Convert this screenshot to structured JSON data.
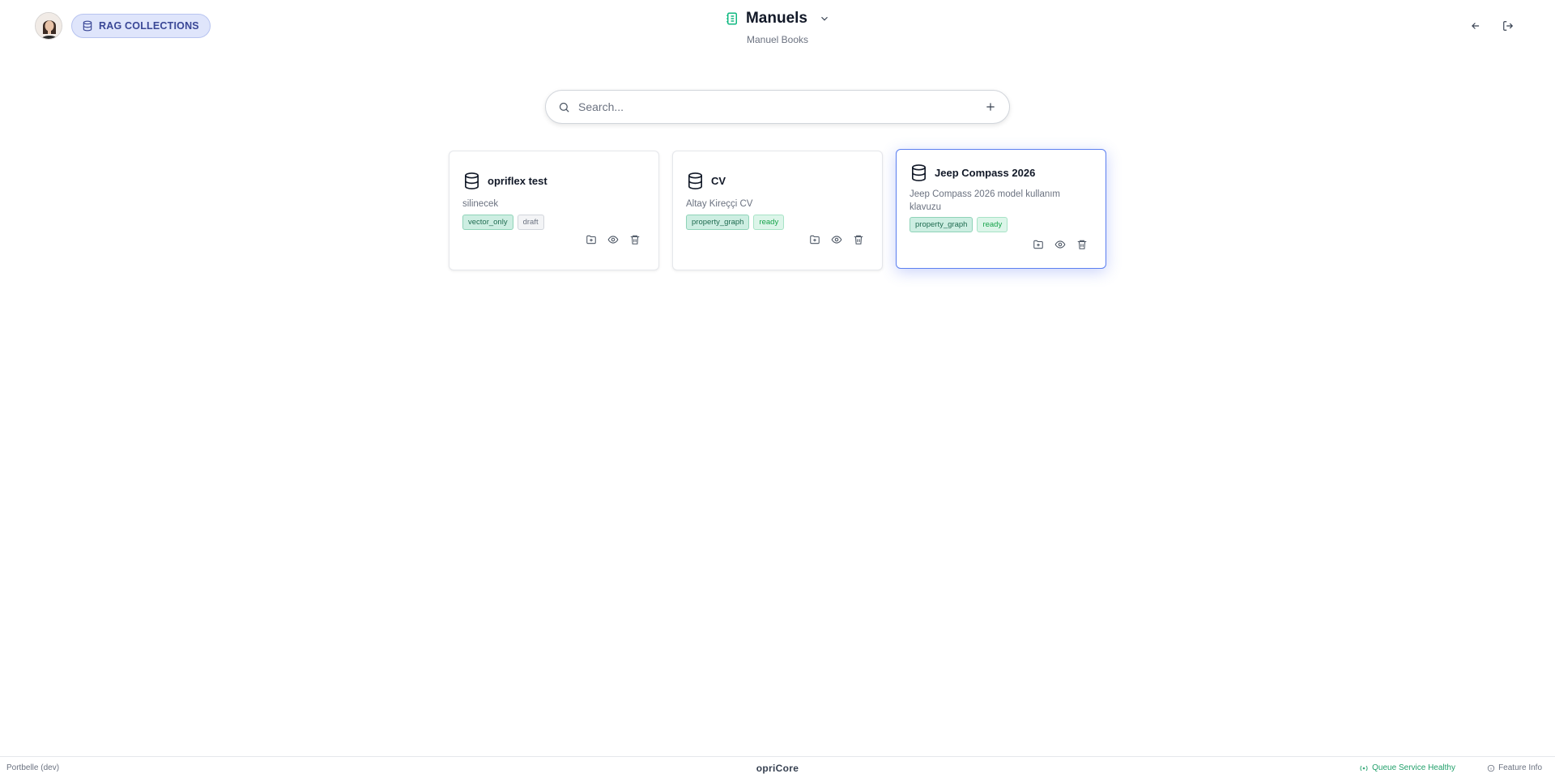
{
  "header": {
    "section_label": "RAG COLLECTIONS",
    "title": "Manuels",
    "subtitle": "Manuel Books"
  },
  "search": {
    "placeholder": "Search..."
  },
  "collections": [
    {
      "name": "opriflex test",
      "description": "silinecek",
      "type_tag": "vector_only",
      "status_tag": "draft"
    },
    {
      "name": "CV",
      "description": "Altay Kireççi CV",
      "type_tag": "property_graph",
      "status_tag": "ready"
    },
    {
      "name": "Jeep Compass 2026",
      "description": "Jeep Compass 2026 model kullanım klavuzu",
      "type_tag": "property_graph",
      "status_tag": "ready",
      "selected": true
    }
  ],
  "footer": {
    "environment": "Portbelle (dev)",
    "brand": "opriCore",
    "queue_status": "Queue Service Healthy",
    "feature_info": "Feature Info"
  },
  "colors": {
    "accent": "#5b7ff0",
    "pill_bg": "#dfe5fb",
    "pill_text": "#3a4796",
    "title_icon": "#10b981",
    "status_ok": "#22a06b"
  },
  "icons": {
    "pill": "database-icon",
    "title": "notebook-icon",
    "card": "database-icon",
    "card_actions": [
      "folder-plus-icon",
      "eye-icon",
      "trash-icon"
    ]
  }
}
